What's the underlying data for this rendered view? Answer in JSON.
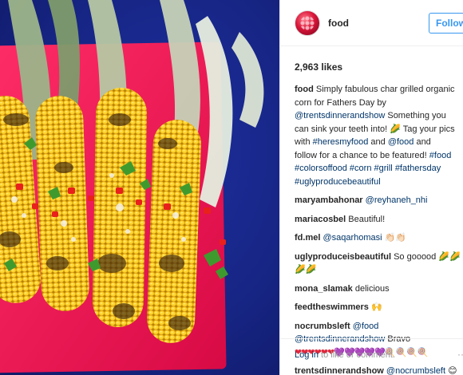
{
  "photo": {
    "alt_subject": "grilled corn"
  },
  "header": {
    "username": "food",
    "follow_label": "Follow"
  },
  "likes": "2,963 likes",
  "caption": {
    "user": "food",
    "line1": "Simply fabulous char grilled organic",
    "line2": "corn for Fathers Day by",
    "line3_link": "@trentsdinnerandshow",
    "line3_text": " Something you",
    "line4": "can sink your teeth into!",
    "line4_emoji": "🌽",
    "line4_tail": " Tag your pics",
    "line5_pre": "with ",
    "line5_link1": "#heresmyfood",
    "line5_mid": " and ",
    "line5_link2": "@food",
    "line5_tail": " and",
    "line6_text": "follow for a chance to be featured! ",
    "line6_link": "#food",
    "line7_link1": "#colorsoffood",
    "line7_link2": "#corn",
    "line7_link3": "#grill",
    "line7_link4": "#fathersday",
    "line8_link": "#uglyproducebeautiful"
  },
  "comments": [
    {
      "user": "maryambahonar",
      "mention": "@reyhaneh_nhi"
    },
    {
      "user": "mariacosbel",
      "text": "Beautiful!"
    },
    {
      "user": "fd.mel",
      "mention": "@saqarhomasi",
      "emoji": "👏🏻👏🏻"
    },
    {
      "user": "uglyproduceisbeautiful",
      "text": "So gooood",
      "emoji": "🌽🌽",
      "emoji2": "🌽🌽"
    },
    {
      "user": "mona_slamak",
      "text": "delicious"
    },
    {
      "user": "feedtheswimmers",
      "emoji": "🙌"
    },
    {
      "user": "nocrumbsleft",
      "mention": "@food",
      "mention2": "@trentsdinnerandshow",
      "text": " Bravo",
      "hearts": "❤❤❤❤❤❤💜💜💜💜💜",
      "lollipops": "🍭🍭🍭🍭"
    },
    {
      "user": "trentsdinnerandshow",
      "mention": "@nocrumbsleft",
      "emoji": "😊"
    }
  ],
  "footer": {
    "login_link": "Log in",
    "login_text": " to like or comment.",
    "more": "···"
  },
  "colors": {
    "accent": "#3897f0",
    "link": "#003569",
    "photo_bg": "#172585",
    "plate": "#e8134f"
  }
}
